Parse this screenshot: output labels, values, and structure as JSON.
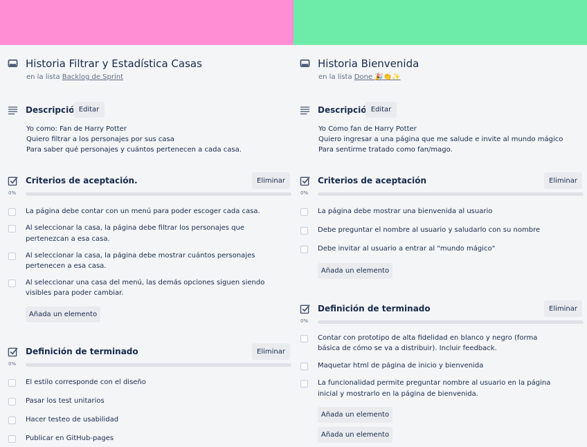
{
  "colors": {
    "left_cover": "#ff8ed4",
    "right_cover": "#6deca9",
    "background": "#f4f5f7",
    "text": "#172b4d"
  },
  "cards": [
    {
      "title": "Historia Filtrar y Estadística Casas",
      "list_prefix": "en la lista",
      "list_name": "Backlog de Sprint",
      "description_heading": "Descripción",
      "edit_label": "Editar",
      "description_lines": [
        "Yo como: Fan de Harry Potter",
        "Quiero filtrar a los personajes por sus casa",
        "Para saber qué personajes y cuántos pertenecen a cada casa."
      ],
      "checklists": [
        {
          "title": "Criterios de aceptación.",
          "delete_label": "Eliminar",
          "progress_label": "0%",
          "progress": 0,
          "items": [
            [
              "La página debe contar con un menú para poder escoger cada casa."
            ],
            [
              "Al seleccionar la casa, la página debe filtrar los personajes que",
              "pertenezcan a esa casa."
            ],
            [
              "Al seleccionar la casa, la página debe mostrar cuántos personajes",
              "pertenecen a esa casa."
            ],
            [
              "Al seleccionar una casa del menú, las demás opciones siguen siendo",
              "visibles para poder cambiar."
            ]
          ],
          "add_label": "Añada un elemento"
        },
        {
          "title": "Definición de terminado",
          "delete_label": "Eliminar",
          "progress_label": "0%",
          "progress": 0,
          "items": [
            [
              "El estilo corresponde con el diseño"
            ],
            [
              "Pasar los test unitarios"
            ],
            [
              "Hacer testeo de usabilidad"
            ],
            [
              "Publicar en GitHub-pages"
            ]
          ]
        }
      ]
    },
    {
      "title": "Historia Bienvenida",
      "list_prefix": "en la lista",
      "list_name": "Done 🎉👏✨",
      "description_heading": "Descripción",
      "edit_label": "Editar",
      "description_lines": [
        "Yo Como fan de Harry Potter",
        "Quiero ingresar a una página que me salude e invite al mundo mágico",
        "Para sentirme tratado como fan/mago."
      ],
      "checklists": [
        {
          "title": "Criterios de aceptación",
          "delete_label": "Eliminar",
          "progress_label": "0%",
          "progress": 0,
          "items": [
            [
              "La página debe mostrar una bienvenida al usuario"
            ],
            [
              "Debe preguntar el nombre al usuario y saludarlo con su nombre"
            ],
            [
              "Debe invitar al usuario a entrar al \"mundo mágico\""
            ]
          ],
          "add_label": "Añada un elemento"
        },
        {
          "title": "Definición de terminado",
          "delete_label": "Eliminar",
          "progress_label": "0%",
          "progress": 0,
          "items": [
            [
              "Contar con prototipo de alta fidelidad en blanco y negro (forma",
              "básica de cómo se va a distribuir). Incluir feedback."
            ],
            [
              "Maquetar html de página de inicio y bienvenida"
            ],
            [
              "La funcionalidad permite preguntar nombre al usuario en la página",
              "inicial y mostrarlo en la página de bienvenida."
            ]
          ],
          "add_label": "Añada un elemento",
          "add_label_2": "Añada un elemento"
        }
      ]
    }
  ]
}
